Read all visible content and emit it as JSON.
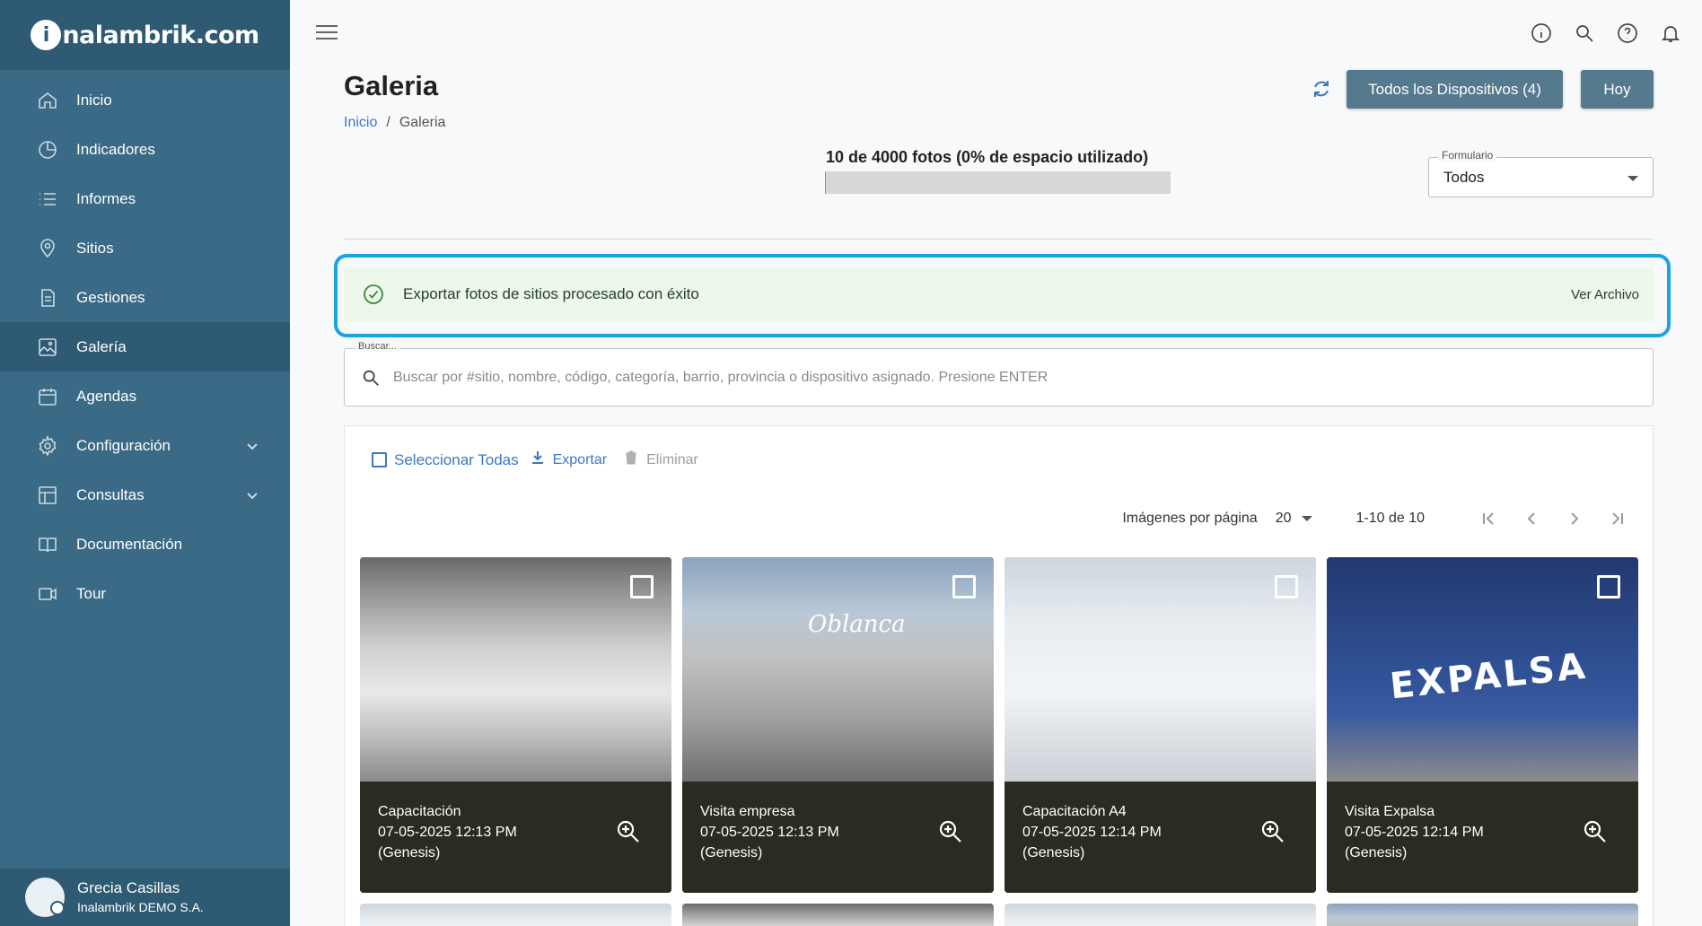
{
  "brand": {
    "logo_text": "nalambrik.com",
    "logo_initial": "i"
  },
  "sidebar": {
    "items": [
      {
        "label": "Inicio",
        "icon": "home-icon"
      },
      {
        "label": "Indicadores",
        "icon": "pie-chart-icon"
      },
      {
        "label": "Informes",
        "icon": "list-icon"
      },
      {
        "label": "Sitios",
        "icon": "location-pin-icon"
      },
      {
        "label": "Gestiones",
        "icon": "document-icon"
      },
      {
        "label": "Galería",
        "icon": "image-icon",
        "active": true
      },
      {
        "label": "Agendas",
        "icon": "calendar-icon"
      },
      {
        "label": "Configuración",
        "icon": "gear-icon",
        "expandable": true
      },
      {
        "label": "Consultas",
        "icon": "table-icon",
        "expandable": true
      },
      {
        "label": "Documentación",
        "icon": "book-icon"
      },
      {
        "label": "Tour",
        "icon": "video-icon"
      }
    ]
  },
  "user": {
    "name": "Grecia Casillas",
    "company": "Inalambrik DEMO S.A."
  },
  "header": {
    "title": "Galeria",
    "breadcrumb": {
      "home": "Inicio",
      "separator": "/",
      "current": "Galeria"
    },
    "devices_button": "Todos los Dispositivos (4)",
    "today_button": "Hoy"
  },
  "quota": {
    "label": "10 de 4000 fotos (0% de espacio utilizado)",
    "used_fraction": 0.0025
  },
  "form_filter": {
    "label": "Formulario",
    "value": "Todos"
  },
  "alert": {
    "message": "Exportar fotos de sitios procesado con éxito",
    "action": "Ver Archivo"
  },
  "search": {
    "label": "Buscar...",
    "placeholder": "Buscar por #sitio, nombre, código, categoría, barrio, provincia o dispositivo asignado. Presione ENTER",
    "value": ""
  },
  "toolbar": {
    "select_all": "Seleccionar Todas",
    "export": "Exportar",
    "delete": "Eliminar"
  },
  "pagination": {
    "per_page_label": "Imágenes por página",
    "per_page": "20",
    "range": "1-10 de 10"
  },
  "photos": [
    {
      "title": "Capacitación",
      "datetime": "07-05-2025 12:13 PM",
      "device": "(Genesis)"
    },
    {
      "title": "Visita empresa",
      "datetime": "07-05-2025 12:13 PM",
      "device": "(Genesis)",
      "sign": "Oblanca"
    },
    {
      "title": "Capacitación A4",
      "datetime": "07-05-2025 12:14 PM",
      "device": "(Genesis)"
    },
    {
      "title": "Visita Expalsa",
      "datetime": "07-05-2025 12:14 PM",
      "device": "(Genesis)",
      "sign": "EXPALSA"
    }
  ],
  "colors": {
    "sidebar": "#3a6a85",
    "accent": "#3b77c4",
    "alert_border": "#1ca3e3",
    "button": "#557a8d"
  }
}
